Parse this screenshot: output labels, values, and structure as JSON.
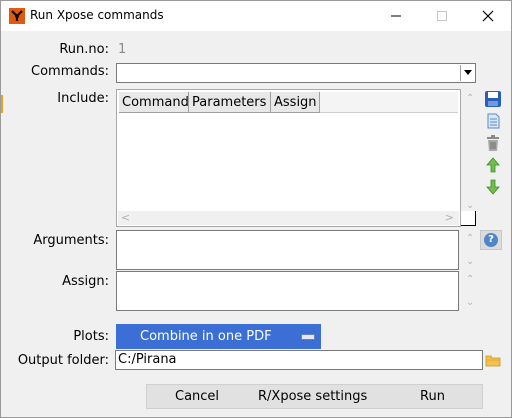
{
  "window": {
    "title": "Run Xpose commands",
    "controls": {
      "minimize": "minimize",
      "maximize": "maximize",
      "close": "close"
    }
  },
  "form": {
    "runno_label": "Run.no:",
    "runno_value": "1",
    "commands_label": "Commands:",
    "commands_value": "",
    "include_label": "Include:",
    "include_columns": [
      "Command",
      "Parameters",
      "Assign"
    ],
    "include_rows": [],
    "arguments_label": "Arguments:",
    "arguments_value": "",
    "assign_label": "Assign:",
    "assign_value": "",
    "plots_label": "Plots:",
    "plots_value": "Combine in one PDF",
    "output_label": "Output folder:",
    "output_value": "C:/Pirana"
  },
  "side_icons": [
    "save-icon",
    "new-document-icon",
    "trash-icon",
    "arrow-up-icon",
    "arrow-down-icon",
    "help-icon"
  ],
  "buttons": {
    "cancel": "Cancel",
    "settings": "R/Xpose settings",
    "run": "Run"
  },
  "colors": {
    "accent": "#3b6fd6",
    "app_icon": "#e05a10"
  }
}
